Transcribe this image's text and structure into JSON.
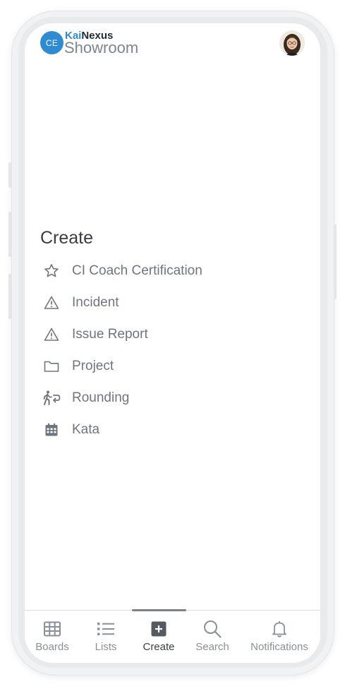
{
  "header": {
    "logo_badge": "CE",
    "logo_kai": "Kai",
    "logo_nexus": "Nexus",
    "logo_sub": "Showroom",
    "avatar_icon": "user-avatar-photo"
  },
  "create": {
    "title": "Create",
    "items": [
      {
        "label": "CI Coach Certification",
        "icon": "star-outline-icon"
      },
      {
        "label": "Incident",
        "icon": "warning-triangle-icon"
      },
      {
        "label": "Issue Report",
        "icon": "warning-triangle-icon"
      },
      {
        "label": "Project",
        "icon": "folder-icon"
      },
      {
        "label": "Rounding",
        "icon": "walking-return-icon"
      },
      {
        "label": "Kata",
        "icon": "calendar-icon"
      }
    ]
  },
  "bottom_nav": {
    "active": "Create",
    "items": [
      {
        "label": "Boards",
        "icon": "grid-icon"
      },
      {
        "label": "Lists",
        "icon": "list-icon"
      },
      {
        "label": "Create",
        "icon": "plus-square-icon"
      },
      {
        "label": "Search",
        "icon": "search-icon"
      },
      {
        "label": "Notifications",
        "icon": "bell-icon"
      }
    ]
  },
  "colors": {
    "brand_blue": "#2e8bd1",
    "text_primary": "#3a3d42",
    "text_secondary": "#6f7580",
    "nav_inactive": "#8a9099"
  }
}
